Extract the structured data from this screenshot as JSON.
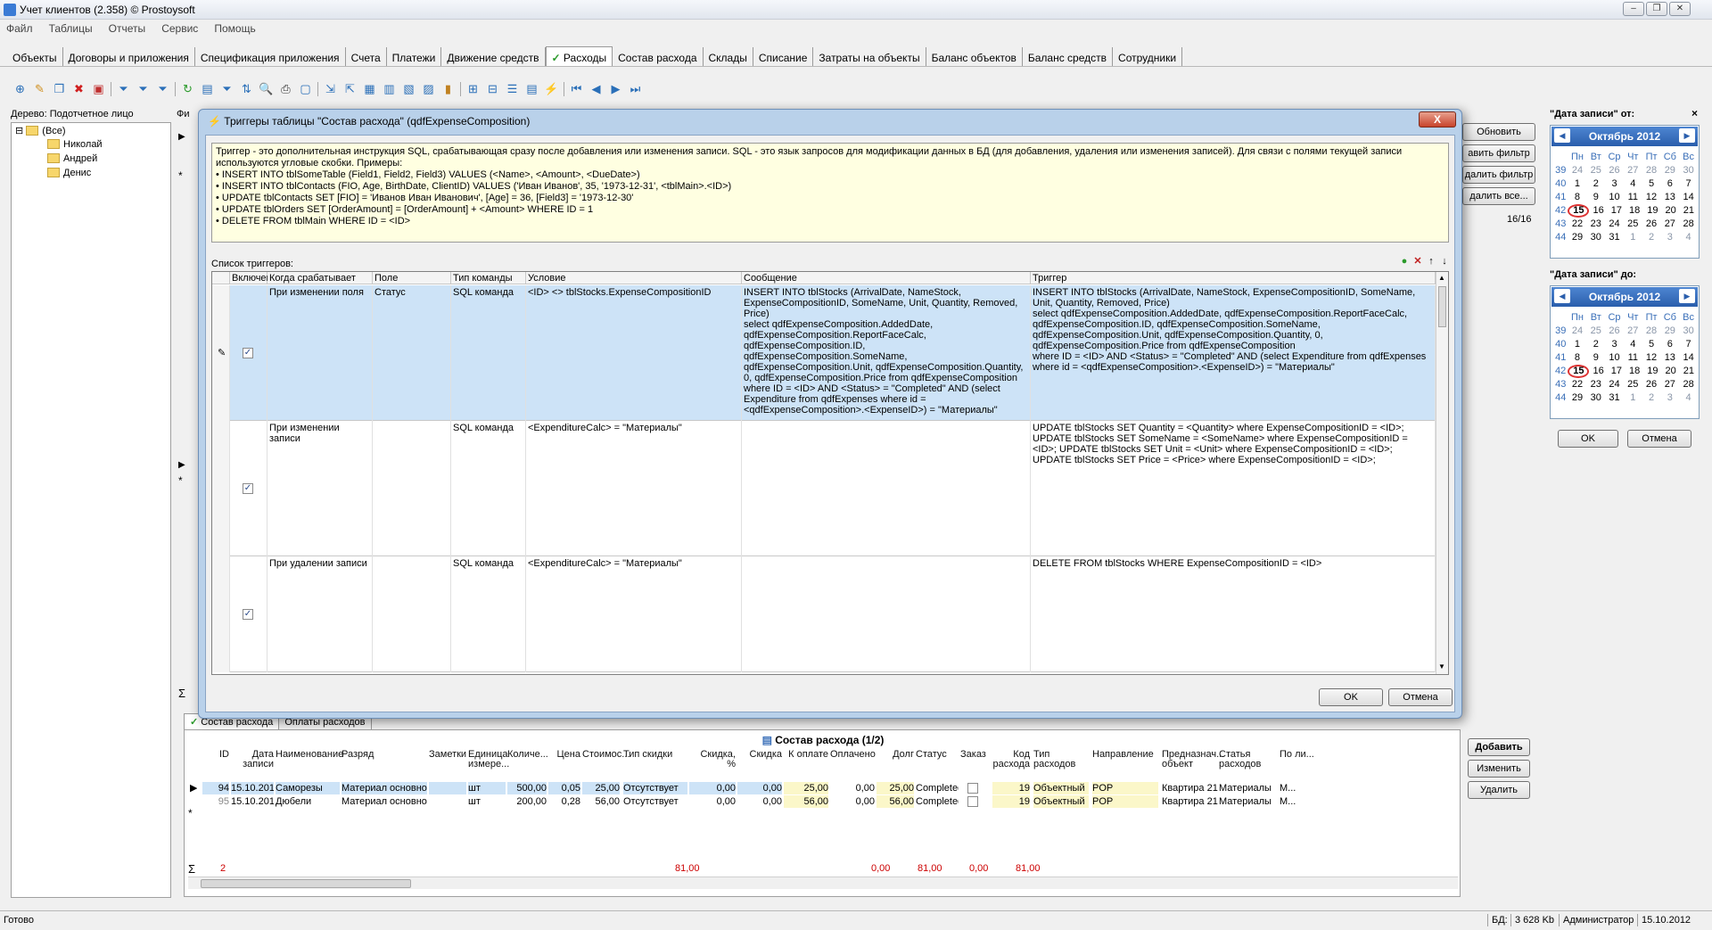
{
  "window": {
    "title": "Учет клиентов (2.358) © Prostoysoft"
  },
  "menu": [
    "Файл",
    "Таблицы",
    "Отчеты",
    "Сервис",
    "Помощь"
  ],
  "tabs": [
    "Объекты",
    "Договоры и приложения",
    "Спецификация приложения",
    "Счета",
    "Платежи",
    "Движение средств",
    "Расходы",
    "Состав расхода",
    "Склады",
    "Списание",
    "Затраты на объекты",
    "Баланс объектов",
    "Баланс средств",
    "Сотрудники"
  ],
  "active_tab": "Расходы",
  "tree": {
    "label": "Дерево: Подотчетное лицо",
    "root": "(Все)",
    "items": [
      "Николай",
      "Андрей",
      "Денис"
    ]
  },
  "main": {
    "filter_label": "Фи",
    "buttons": [
      "Обновить",
      "авить фильтр",
      "далить фильтр",
      "далить все..."
    ],
    "counter": "16/16"
  },
  "calendar": {
    "from_label": "\"Дата записи\" от:",
    "to_label": "\"Дата записи\" до:",
    "month": "Октябрь 2012",
    "weekdays": [
      "Пн",
      "Вт",
      "Ср",
      "Чт",
      "Пт",
      "Сб",
      "Вс"
    ],
    "weeks": [
      {
        "wk": "39",
        "days": [
          "24",
          "25",
          "26",
          "27",
          "28",
          "29",
          "30"
        ]
      },
      {
        "wk": "40",
        "days": [
          "1",
          "2",
          "3",
          "4",
          "5",
          "6",
          "7"
        ]
      },
      {
        "wk": "41",
        "days": [
          "8",
          "9",
          "10",
          "11",
          "12",
          "13",
          "14"
        ]
      },
      {
        "wk": "42",
        "days": [
          "15",
          "16",
          "17",
          "18",
          "19",
          "20",
          "21"
        ]
      },
      {
        "wk": "43",
        "days": [
          "22",
          "23",
          "24",
          "25",
          "26",
          "27",
          "28"
        ]
      },
      {
        "wk": "44",
        "days": [
          "29",
          "30",
          "31",
          "1",
          "2",
          "3",
          "4"
        ]
      }
    ],
    "today": "15",
    "ok": "OK",
    "cancel": "Отмена"
  },
  "dialog": {
    "title": "Триггеры таблицы \"Состав расхода\" (qdfExpenseComposition)",
    "close": "X",
    "info": "Триггер - это дополнительная инструкция SQL, срабатывающая сразу после добавления или изменения записи. SQL - это язык запросов для модификации данных в БД (для добавления, удаления или изменения записей). Для связи с полями текущей записи используются угловые скобки. Примеры:\n• INSERT INTO tblSomeTable (Field1, Field2, Field3) VALUES (<Name>, <Amount>, <DueDate>)\n• INSERT INTO tblContacts (FIO, Age, BirthDate, ClientID) VALUES ('Иван Иванов', 35, '1973-12-31', <tblMain>.<ID>)\n• UPDATE tblContacts SET [FIO] = 'Иванов Иван Иванович', [Age] = 36, [Field3] = '1973-12-30'\n• UPDATE tblOrders SET [OrderAmount] = [OrderAmount] + <Amount> WHERE ID = 1\n• DELETE FROM tblMain WHERE ID = <ID>",
    "list_label": "Список триггеров:",
    "columns": [
      "Включен",
      "Когда срабатывает",
      "Поле",
      "Тип команды",
      "Условие",
      "Сообщение",
      "Триггер"
    ],
    "rows": [
      {
        "enabled": "✓",
        "when": "При изменении поля",
        "field": "Статус",
        "type": "SQL команда",
        "condition": "<ID> <> tblStocks.ExpenseCompositionID",
        "message": "INSERT INTO tblStocks (ArrivalDate, NameStock, ExpenseCompositionID, SomeName, Unit, Quantity, Removed, Price)\nselect qdfExpenseComposition.AddedDate, qdfExpenseComposition.ReportFaceCalc, qdfExpenseComposition.ID, qdfExpenseComposition.SomeName, qdfExpenseComposition.Unit, qdfExpenseComposition.Quantity, 0, qdfExpenseComposition.Price from qdfExpenseComposition\nwhere ID = <ID> AND <Status> = \"Completed\" AND (select Expenditure from qdfExpenses where id = <qdfExpenseComposition>.<ExpenseID>) = \"Материалы\"",
        "trigger": "INSERT INTO tblStocks (ArrivalDate, NameStock, ExpenseCompositionID, SomeName, Unit, Quantity, Removed, Price)\nselect qdfExpenseComposition.AddedDate, qdfExpenseComposition.ReportFaceCalc, qdfExpenseComposition.ID, qdfExpenseComposition.SomeName, qdfExpenseComposition.Unit, qdfExpenseComposition.Quantity, 0, qdfExpenseComposition.Price from qdfExpenseComposition\nwhere ID = <ID> AND <Status> = \"Completed\" AND (select Expenditure from qdfExpenses where id = <qdfExpenseComposition>.<ExpenseID>) = \"Материалы\""
      },
      {
        "enabled": "✓",
        "when": "При изменении записи",
        "field": "",
        "type": "SQL команда",
        "condition": "<ExpenditureCalc> = \"Материалы\"",
        "message": "",
        "trigger": "UPDATE tblStocks SET Quantity = <Quantity> where ExpenseCompositionID = <ID>; UPDATE tblStocks SET SomeName = <SomeName> where ExpenseCompositionID = <ID>; UPDATE tblStocks SET Unit = <Unit> where ExpenseCompositionID = <ID>; UPDATE tblStocks SET Price = <Price> where ExpenseCompositionID = <ID>;"
      },
      {
        "enabled": "✓",
        "when": "При удалении записи",
        "field": "",
        "type": "SQL команда",
        "condition": "<ExpenditureCalc> = \"Материалы\"",
        "message": "",
        "trigger": "DELETE FROM tblStocks WHERE ExpenseCompositionID = <ID>"
      }
    ],
    "ok": "OK",
    "cancel": "Отмена"
  },
  "lower": {
    "tabs": [
      "Состав расхода",
      "Оплаты расходов"
    ],
    "title": "Состав расхода (1/2)",
    "columns": [
      "ID",
      "Дата записи",
      "Наименование",
      "Разряд",
      "Заметки",
      "Единица измере...",
      "Количе...",
      "Цена",
      "Стоимос...",
      "Тип скидки",
      "Скидка, %",
      "Скидка",
      "К оплате",
      "Оплачено",
      "Долг",
      "Статус",
      "Заказ",
      "Код расхода",
      "Тип расходов",
      "Направление",
      "Предназнач... объект",
      "Статья расходов",
      "По ли..."
    ],
    "rows": [
      [
        "94",
        "15.10.2012",
        "Саморезы",
        "Материал основной",
        "",
        "шт",
        "500,00",
        "0,05",
        "25,00",
        "Отсутствует",
        "0,00",
        "0,00",
        "25,00",
        "0,00",
        "25,00",
        "Completed",
        "",
        "19",
        "Объектный",
        "POP",
        "Квартира 21",
        "Материалы",
        "М..."
      ],
      [
        "95",
        "15.10.2012",
        "Дюбели",
        "Материал основной",
        "",
        "шт",
        "200,00",
        "0,28",
        "56,00",
        "Отсутствует",
        "0,00",
        "0,00",
        "56,00",
        "0,00",
        "56,00",
        "Completed",
        "",
        "19",
        "Объектный",
        "POP",
        "Квартира 21",
        "Материалы",
        "М..."
      ]
    ],
    "totals": {
      "count": "2",
      "cost": "81,00",
      "discount": "0,00",
      "topay": "81,00",
      "paid": "0,00",
      "debt": "81,00"
    },
    "buttons": [
      "Добавить",
      "Изменить",
      "Удалить"
    ]
  },
  "status": {
    "left": "Готово",
    "db": "БД:",
    "size": "3 628 Kb",
    "user": "Администратор",
    "date": "15.10.2012"
  }
}
